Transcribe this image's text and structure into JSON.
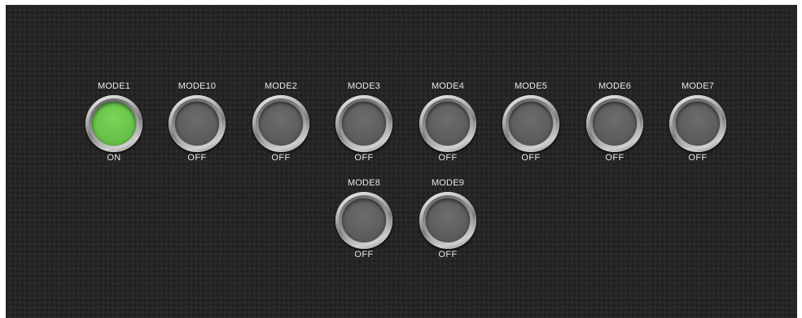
{
  "colors": {
    "panel_background": "#262626",
    "on_lens": "#67c248",
    "off_lens": "#5d5d5d",
    "label_text": "#e8e8e8"
  },
  "buttons": [
    {
      "label": "MODE1",
      "state": "ON",
      "active": true
    },
    {
      "label": "MODE10",
      "state": "OFF",
      "active": false
    },
    {
      "label": "MODE2",
      "state": "OFF",
      "active": false
    },
    {
      "label": "MODE3",
      "state": "OFF",
      "active": false
    },
    {
      "label": "MODE4",
      "state": "OFF",
      "active": false
    },
    {
      "label": "MODE5",
      "state": "OFF",
      "active": false
    },
    {
      "label": "MODE6",
      "state": "OFF",
      "active": false
    },
    {
      "label": "MODE7",
      "state": "OFF",
      "active": false
    },
    {
      "label": "MODE8",
      "state": "OFF",
      "active": false
    },
    {
      "label": "MODE9",
      "state": "OFF",
      "active": false
    }
  ]
}
